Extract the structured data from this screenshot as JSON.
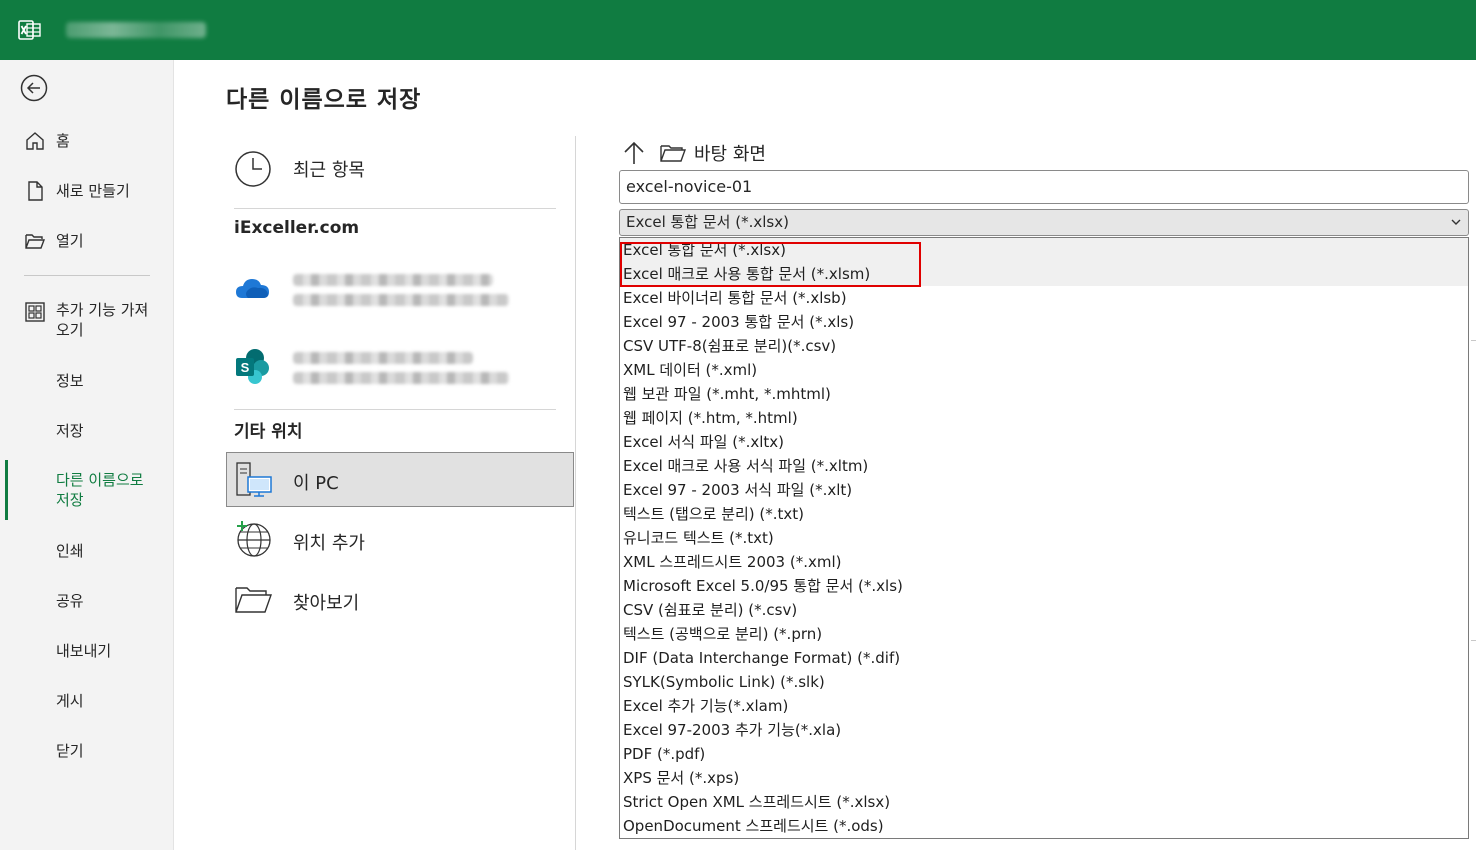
{
  "window": {
    "title": "다른 이름으로 저장"
  },
  "nav": {
    "items": [
      {
        "label": "홈",
        "icon": "home-icon"
      },
      {
        "label": "새로 만들기",
        "icon": "new-file-icon"
      },
      {
        "label": "열기",
        "icon": "open-folder-icon"
      },
      {
        "label": "추가 기능 가져\n오기",
        "icon": "addins-icon"
      },
      {
        "label": "정보"
      },
      {
        "label": "저장"
      },
      {
        "label": "다른 이름으로\n저장",
        "active": true
      },
      {
        "label": "인쇄"
      },
      {
        "label": "공유"
      },
      {
        "label": "내보내기"
      },
      {
        "label": "게시"
      },
      {
        "label": "닫기"
      }
    ]
  },
  "locations": {
    "recent": "최근 항목",
    "cloud_heading": "iExceller.com",
    "other_heading": "기타 위치",
    "this_pc": "이 PC",
    "add_place": "위치 추가",
    "browse": "찾아보기"
  },
  "save": {
    "path": "바탕 화면",
    "filename": "excel-novice-01",
    "selected_format": "Excel 통합 문서 (*.xlsx)"
  },
  "formats": [
    "Excel 통합 문서 (*.xlsx)",
    "Excel 매크로 사용 통합 문서 (*.xlsm)",
    "Excel 바이너리 통합 문서 (*.xlsb)",
    "Excel 97 - 2003 통합 문서 (*.xls)",
    "CSV UTF-8(쉼표로 분리)(*.csv)",
    "XML 데이터 (*.xml)",
    "웹 보관 파일 (*.mht, *.mhtml)",
    "웹 페이지 (*.htm, *.html)",
    "Excel 서식 파일 (*.xltx)",
    "Excel 매크로 사용 서식 파일 (*.xltm)",
    "Excel 97 - 2003 서식 파일 (*.xlt)",
    "텍스트 (탭으로 분리) (*.txt)",
    "유니코드 텍스트 (*.txt)",
    "XML 스프레드시트 2003 (*.xml)",
    "Microsoft Excel 5.0/95 통합 문서 (*.xls)",
    "CSV (쉼표로 분리) (*.csv)",
    "텍스트 (공백으로 분리) (*.prn)",
    "DIF (Data Interchange Format) (*.dif)",
    "SYLK(Symbolic Link) (*.slk)",
    "Excel 추가 기능(*.xlam)",
    "Excel 97-2003 추가 기능(*.xla)",
    "PDF (*.pdf)",
    "XPS 문서 (*.xps)",
    "Strict Open XML 스프레드시트 (*.xlsx)",
    "OpenDocument 스프레드시트 (*.ods)"
  ],
  "colors": {
    "brand": "#107c41",
    "highlight_box": "#e00000"
  }
}
